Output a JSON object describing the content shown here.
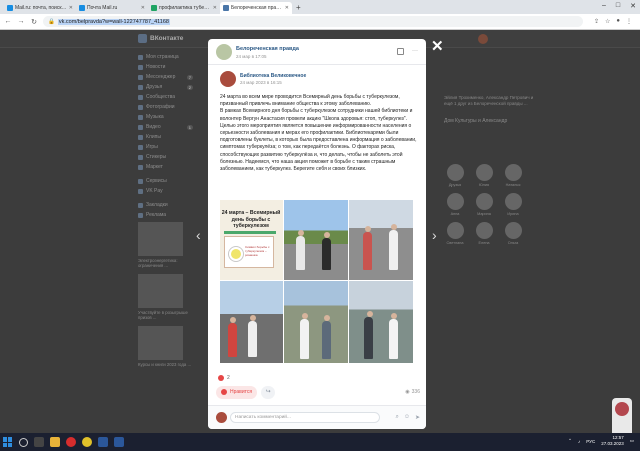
{
  "browser": {
    "tabs": [
      {
        "label": "Mail.ru: почта, поиск в интернете",
        "favicon_color": "#168de2"
      },
      {
        "label": "Почта Mail.ru",
        "favicon_color": "#168de2"
      },
      {
        "label": "профилактика туберкулеза (ДОСУГ)",
        "favicon_color": "#1fa463"
      },
      {
        "label": "Белореченская правда",
        "favicon_color": "#4a76a8",
        "active": true
      }
    ],
    "new_tab": "+",
    "url": "vk.com/belpravda?w=wall-122747787_41168"
  },
  "vk": {
    "logo": "ВКонтакте",
    "nav": [
      {
        "label": "Моя страница",
        "count": ""
      },
      {
        "label": "Новости",
        "count": ""
      },
      {
        "label": "Мессенджер",
        "count": "7"
      },
      {
        "label": "Друзья",
        "count": "2"
      },
      {
        "label": "Сообщества",
        "count": ""
      },
      {
        "label": "Фотографии",
        "count": ""
      },
      {
        "label": "Музыка",
        "count": ""
      },
      {
        "label": "Видео",
        "count": "1"
      },
      {
        "label": "Клипы",
        "count": ""
      },
      {
        "label": "Игры",
        "count": ""
      },
      {
        "label": "Стикеры",
        "count": ""
      },
      {
        "label": "Маркет",
        "count": ""
      },
      {
        "label": "Сервисы",
        "count": ""
      },
      {
        "label": "VK Pay",
        "count": ""
      },
      {
        "label": "Закладки",
        "count": ""
      },
      {
        "label": "Реклама",
        "count": ""
      }
    ],
    "ads": [
      "Электроэнергетика: ограничения ...",
      "Участвуйте в розыгрыше призов ...",
      "Курсы и книги 2023 года ..."
    ],
    "right_text": "Эйлия Трохименко, Александр Петрович и ещё 1 друг из Белореченской правды ...",
    "right_link": "Дом Культуры и Александр",
    "friends": [
      "Друзья",
      "Юлия",
      "Наталья",
      "Анна",
      "Марина",
      "Ирина",
      "Светлана",
      "Елена",
      "Ольга"
    ]
  },
  "post": {
    "group": "Белореченская правда",
    "group_date": "24 мар в 17:05",
    "repost_author": "Библиотека Великовечное",
    "repost_date": "24 мар 2023 в 16:15",
    "paragraphs": [
      "24 марта во всем мире проводится Всемирный день борьбы с туберкулезом, призванный привлечь внимание общества к этому заболеванию.",
      "В рамках Всемирного дня борьбы с туберкулезом сотрудники нашей библиотеки и волонтер Вергун Анастасия провели акцию \"Школа здоровья: стоп, туберкулез\". Целью этого мероприятия является повышение информированности населения о серьезности заболевания и мерах его профилактики. Библиотекарями были подготовлены буклеты, в которых была предоставлена информация о заболевании, симптомах туберкулёза; о том, как передаётся болезнь. О факторах риска, способствующих развитию туберкулёза и, что делать, чтобы не заболеть этой болезнью. Надеемся, что наша акция поможет в борьбе с таким страшным заболеванием, как туберкулез. Берегите себя и своих близких."
    ],
    "poster_title": "24 марта – Всемирный день борьбы с туберкулезом",
    "poster_card_text": "Символ борьбы с туберкулезом – ромашка",
    "likes_count": "2",
    "like_label": "Нравится",
    "views": "336",
    "comment_placeholder": "Написать комментарий..."
  },
  "taskbar": {
    "lang": "РУС",
    "time": "12:57",
    "date": "27.03.2023"
  }
}
